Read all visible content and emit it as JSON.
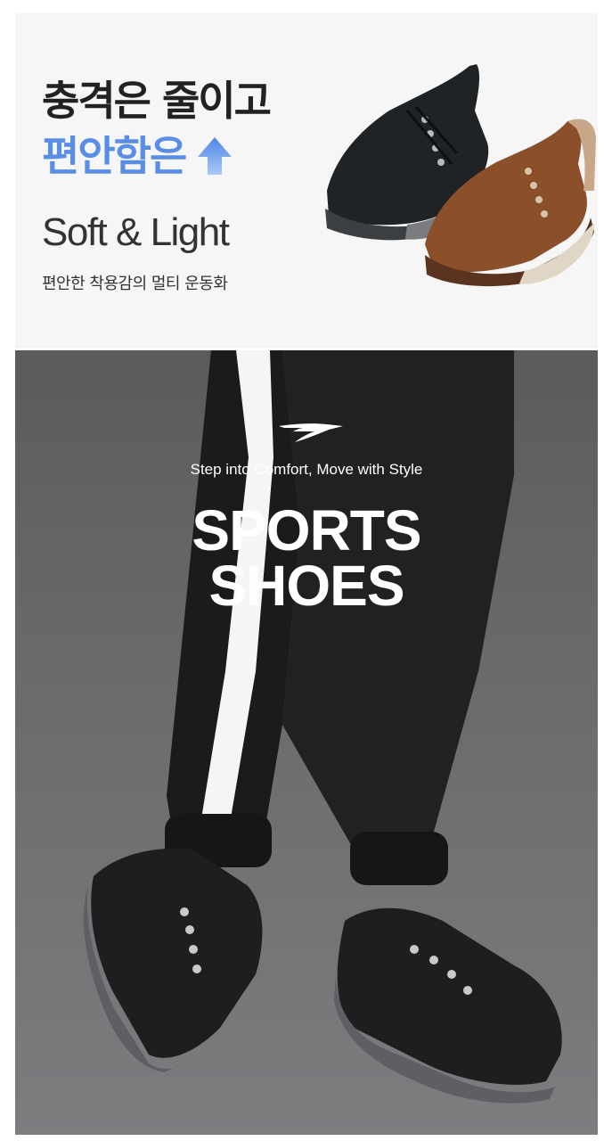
{
  "banner": {
    "headline_line1": "충격은 줄이고",
    "headline_line2": "편안함은",
    "headline_line2_color": "#5a8ee6",
    "arrow_icon": "up-arrow-icon",
    "subtitle_en": "Soft & Light",
    "description": "편안한 착용감의 멀티 운동화",
    "product_colors": [
      "black",
      "brown"
    ]
  },
  "hero": {
    "brand_icon": "swoosh-logo-icon",
    "tagline": "Step into Comfort, Move with Style",
    "title_line1": "SPORTS",
    "title_line2": "SHOES"
  }
}
